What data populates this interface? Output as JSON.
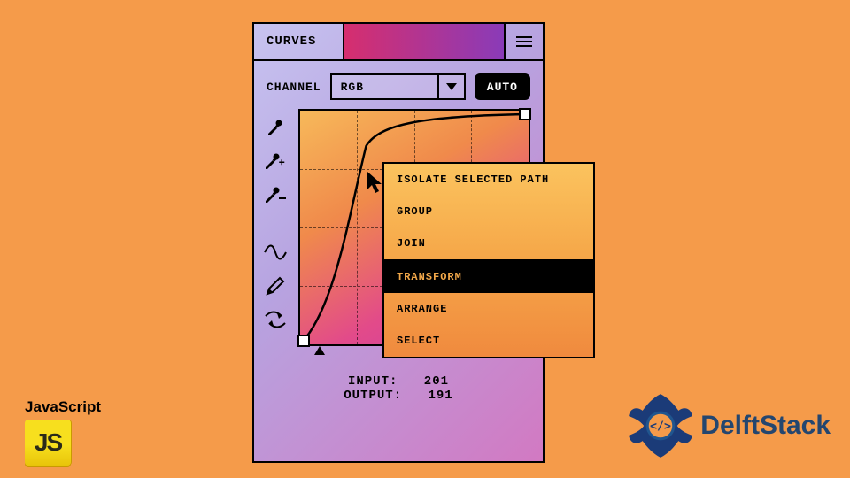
{
  "panel": {
    "title": "CURVES",
    "channel_label": "CHANNEL",
    "channel_value": "RGB",
    "auto_label": "AUTO"
  },
  "tools": [
    {
      "name": "eyedropper",
      "icon": "eyedropper-icon"
    },
    {
      "name": "eyedropper-add",
      "icon": "eyedropper-plus-icon"
    },
    {
      "name": "eyedropper-sub",
      "icon": "eyedropper-minus-icon"
    },
    {
      "name": "smooth-curve",
      "icon": "wave-icon"
    },
    {
      "name": "pencil",
      "icon": "pencil-icon"
    },
    {
      "name": "smooth-points",
      "icon": "arrows-curve-icon"
    }
  ],
  "readout": {
    "input_label": "INPUT:",
    "input_value": "201",
    "output_label": "OUTPUT:",
    "output_value": "191"
  },
  "context_menu": {
    "items": [
      {
        "label": "ISOLATE SELECTED PATH",
        "selected": false
      },
      {
        "label": "GROUP",
        "selected": false
      },
      {
        "label": "JOIN",
        "selected": false
      },
      {
        "label": "TRANSFORM",
        "selected": true
      },
      {
        "label": "ARRANGE",
        "selected": false
      },
      {
        "label": "SELECT",
        "selected": false
      }
    ]
  },
  "brand_js": {
    "label": "JavaScript",
    "logo_text": "JS"
  },
  "brand_delft": {
    "label": "DelftStack"
  }
}
